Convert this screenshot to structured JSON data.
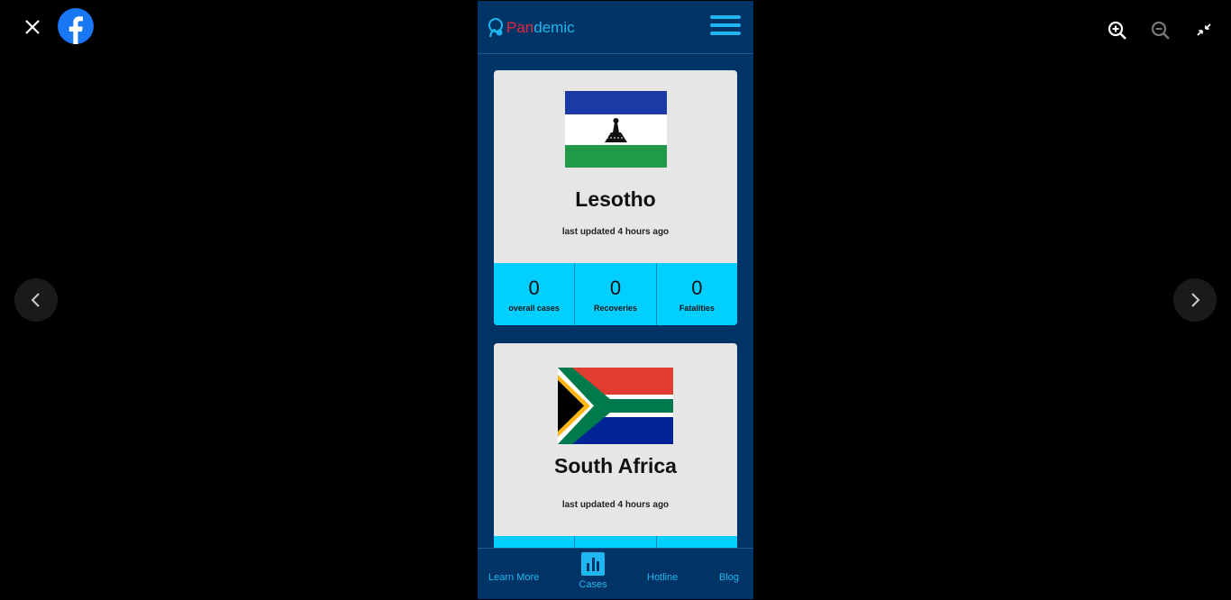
{
  "viewer": {
    "close_icon": "close-icon",
    "brand_icon": "facebook-logo-icon",
    "zoom_in_icon": "zoom-in-icon",
    "zoom_out_icon": "zoom-out-icon",
    "exit_fullscreen_icon": "exit-fullscreen-icon",
    "prev_icon": "chevron-left-icon",
    "next_icon": "chevron-right-icon"
  },
  "app": {
    "logo_pan": "Pan",
    "logo_demic": "demic",
    "menu_icon": "hamburger-menu-icon"
  },
  "cards": [
    {
      "country": "Lesotho",
      "updated": "last updated 4 hours ago",
      "stats": [
        {
          "value": "0",
          "label": "overall cases"
        },
        {
          "value": "0",
          "label": "Recoveries"
        },
        {
          "value": "0",
          "label": "Fatalities"
        }
      ]
    },
    {
      "country": "South Africa",
      "updated": "last updated 4 hours ago"
    }
  ],
  "bottom_nav": {
    "learn_more": "Learn More",
    "cases": "Cases",
    "hotline": "Hotline",
    "blog": "Blog"
  },
  "colors": {
    "app_bg": "#003466",
    "accent": "#1fb7ef",
    "stats_bg": "#00cfff",
    "card_bg": "#e6e6e6"
  }
}
